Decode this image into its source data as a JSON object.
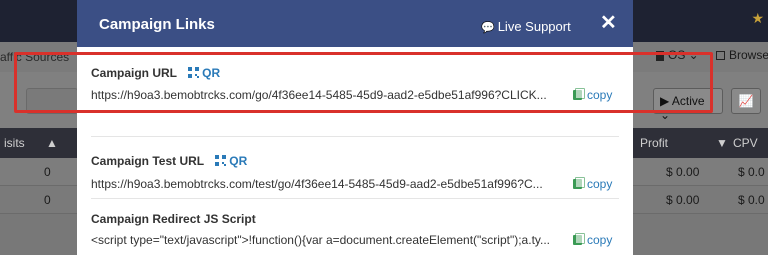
{
  "background": {
    "filter_left": "affic Sources",
    "os_label": "OS",
    "browse_label": "Browse",
    "active_label": "Active",
    "table_headers": {
      "visits": "isits",
      "profit": "Profit",
      "cpv": "CPV"
    },
    "rows": [
      {
        "visits": "0",
        "profit": "$ 0.00",
        "cpv": "$ 0.0"
      },
      {
        "visits": "0",
        "profit": "$ 0.00",
        "cpv": "$ 0.0"
      }
    ]
  },
  "modal": {
    "title": "Campaign Links",
    "live_support": "Live Support",
    "close": "✕",
    "sections": [
      {
        "label": "Campaign URL",
        "qr": "QR",
        "url": "https://h9oa3.bemobtrcks.com/go/4f36ee14-5485-45d9-aad2-e5dbe51af996?CLICK...",
        "copy": "copy"
      },
      {
        "label": "Campaign Test URL",
        "qr": "QR",
        "url": "https://h9oa3.bemobtrcks.com/test/go/4f36ee14-5485-45d9-aad2-e5dbe51af996?C...",
        "copy": "copy"
      },
      {
        "label": "Campaign Redirect JS Script",
        "url": "<script type=\"text/javascript\">!function(){var a=document.createElement(\"script\");a.ty...",
        "copy": "copy"
      }
    ]
  },
  "colors": {
    "header_bg": "#3b4f85",
    "link_blue": "#2a7ab8",
    "copy_green": "#3a9a54",
    "highlight_red": "#d9312b"
  }
}
